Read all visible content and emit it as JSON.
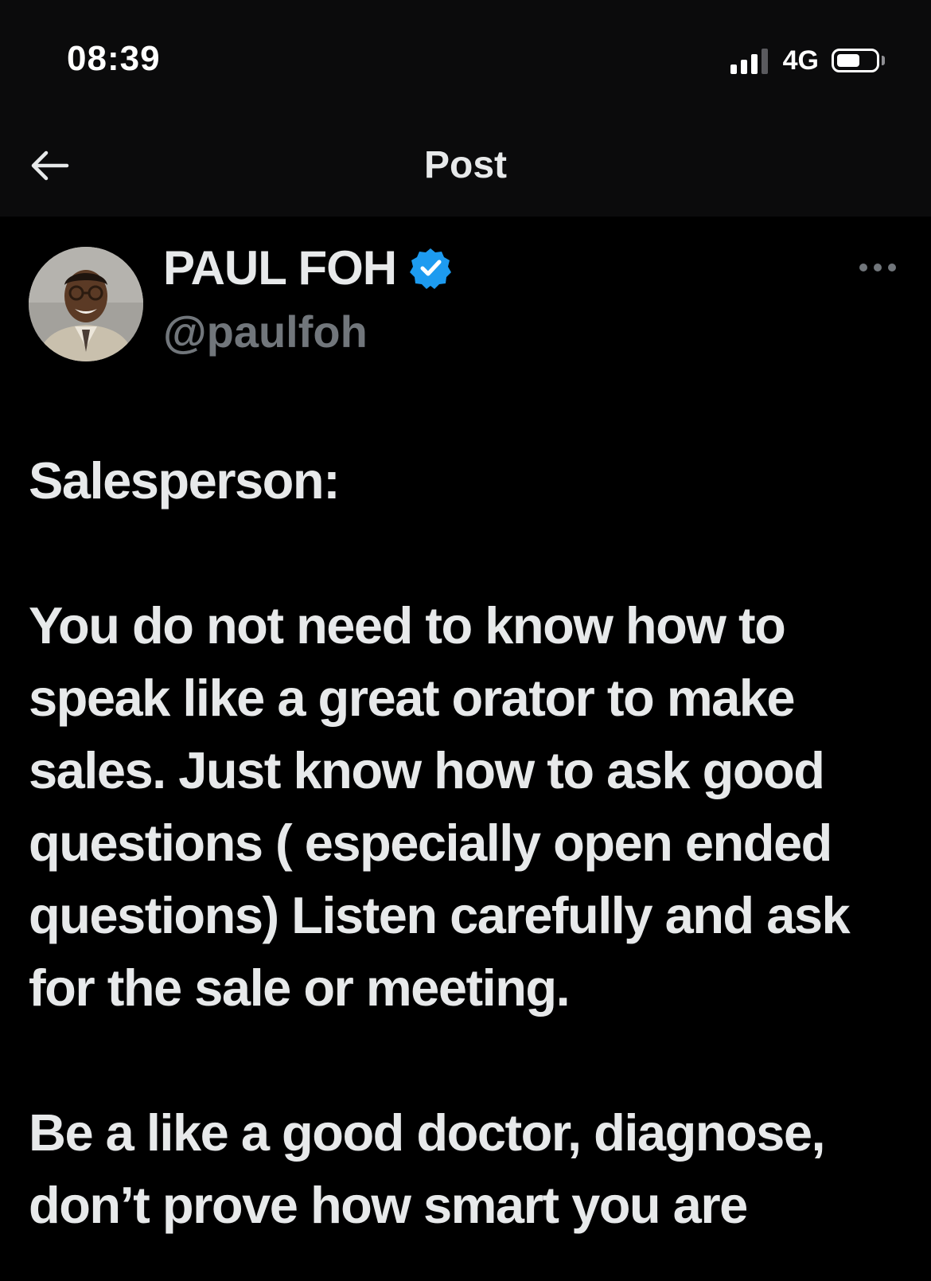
{
  "status_bar": {
    "time": "08:39",
    "network": "4G",
    "signal_bars_active": 3,
    "signal_bars_total": 4,
    "battery_level": 0.6
  },
  "nav": {
    "title": "Post",
    "back_icon": "arrow-left-icon"
  },
  "author": {
    "display_name": "PAUL FOH",
    "handle": "@paulfoh",
    "verified": true,
    "verified_color": "#1d9bf0"
  },
  "post": {
    "paragraphs": [
      "Salesperson:",
      "You do not need to know how to speak like a great orator to make sales. Just know how to ask good questions ( especially open ended questions) Listen carefully and ask for the sale or meeting.",
      "Be a like a good doctor, diagnose, don’t prove how smart you are"
    ]
  },
  "colors": {
    "background": "#000000",
    "header_background": "#0b0b0c",
    "text_primary": "#e7e9ea",
    "text_secondary": "#71767b",
    "accent": "#1d9bf0"
  }
}
